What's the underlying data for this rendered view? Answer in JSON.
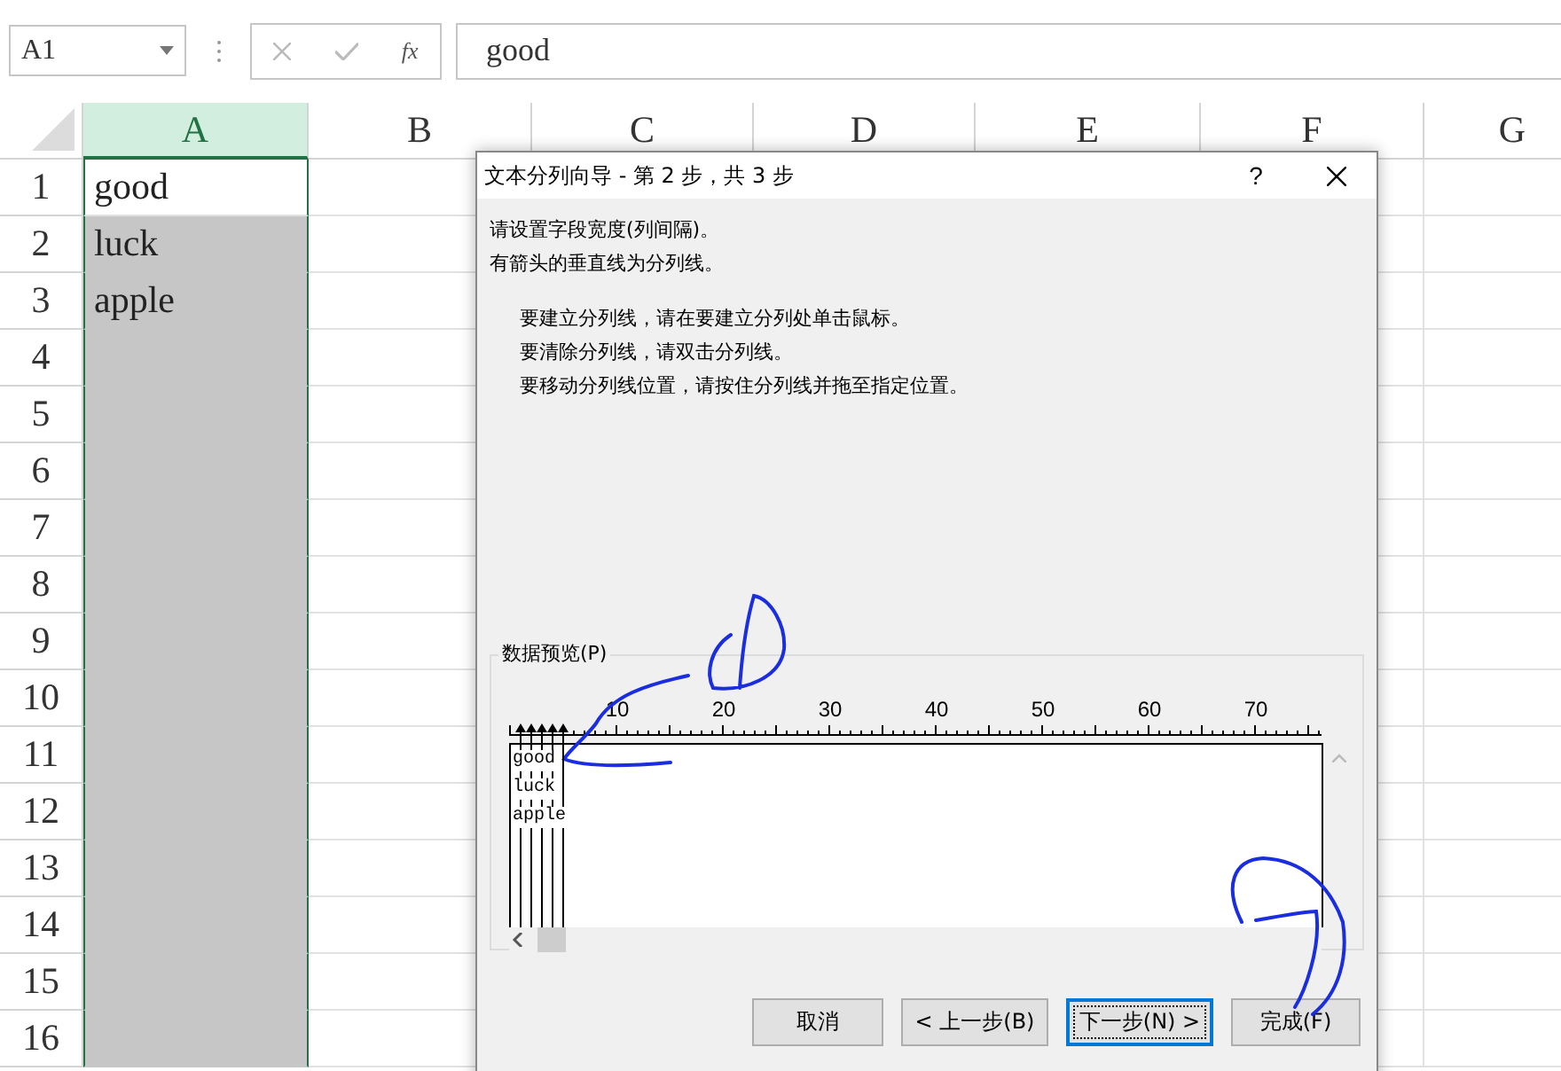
{
  "name_box": {
    "value": "A1"
  },
  "formula_bar": {
    "function_label": "fx",
    "value": "good"
  },
  "columns": [
    {
      "label": "A",
      "selected": true
    },
    {
      "label": "B",
      "selected": false
    },
    {
      "label": "C",
      "selected": false
    },
    {
      "label": "D",
      "selected": false
    },
    {
      "label": "E",
      "selected": false
    },
    {
      "label": "F",
      "selected": false
    },
    {
      "label": "G",
      "selected": false
    }
  ],
  "rows": [
    {
      "label": "1",
      "cells": [
        "good"
      ]
    },
    {
      "label": "2",
      "cells": [
        "luck"
      ]
    },
    {
      "label": "3",
      "cells": [
        "apple"
      ]
    },
    {
      "label": "4",
      "cells": []
    },
    {
      "label": "5",
      "cells": []
    },
    {
      "label": "6",
      "cells": []
    },
    {
      "label": "7",
      "cells": []
    },
    {
      "label": "8",
      "cells": []
    },
    {
      "label": "9",
      "cells": []
    },
    {
      "label": "10",
      "cells": []
    },
    {
      "label": "11",
      "cells": []
    },
    {
      "label": "12",
      "cells": []
    },
    {
      "label": "13",
      "cells": []
    },
    {
      "label": "14",
      "cells": []
    },
    {
      "label": "15",
      "cells": []
    },
    {
      "label": "16",
      "cells": []
    }
  ],
  "dialog": {
    "title": "文本分列向导 - 第 2 步，共 3 步",
    "help": "?",
    "instructions": [
      "请设置字段宽度(列间隔)。",
      "有箭头的垂直线为分列线。"
    ],
    "tips": [
      "要建立分列线，请在要建立分列处单击鼠标。",
      "要清除分列线，请双击分列线。",
      "要移动分列线位置，请按住分列线并拖至指定位置。"
    ],
    "preview": {
      "label": "数据预览(P)",
      "ruler_labels": [
        "10",
        "20",
        "30",
        "40",
        "50",
        "60",
        "70"
      ],
      "lines": [
        "good",
        "luck",
        "apple"
      ]
    },
    "buttons": [
      {
        "label": "取消",
        "focused": false
      },
      {
        "label": "< 上一步(B)",
        "focused": false
      },
      {
        "label": "下一步(N) >",
        "focused": true
      },
      {
        "label": "完成(F)",
        "focused": false
      }
    ]
  }
}
